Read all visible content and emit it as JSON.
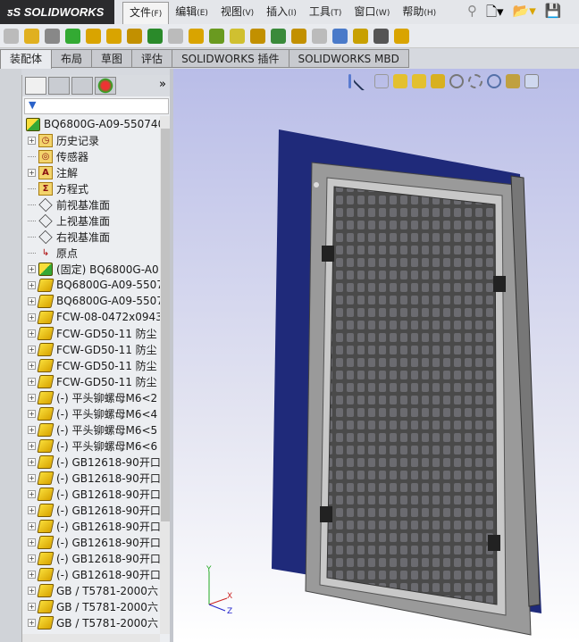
{
  "app": {
    "logo": "SOLIDWORKS"
  },
  "menu": [
    {
      "label": "文件",
      "key": "(F)"
    },
    {
      "label": "编辑",
      "key": "(E)"
    },
    {
      "label": "视图",
      "key": "(V)"
    },
    {
      "label": "插入",
      "key": "(I)"
    },
    {
      "label": "工具",
      "key": "(T)"
    },
    {
      "label": "窗口",
      "key": "(W)"
    },
    {
      "label": "帮助",
      "key": "(H)"
    }
  ],
  "tabs": [
    "装配体",
    "布局",
    "草图",
    "评估",
    "SOLIDWORKS 插件",
    "SOLIDWORKS MBD"
  ],
  "panel": {
    "more": "»",
    "filter": "▼"
  },
  "tree": {
    "root": "BQ6800G-A09-550740",
    "items": [
      {
        "label": "历史记录",
        "icon": "history-folder",
        "exp": true
      },
      {
        "label": "传感器",
        "icon": "sensor-folder",
        "exp": false
      },
      {
        "label": "注解",
        "icon": "annotation-folder",
        "exp": true
      },
      {
        "label": "方程式",
        "icon": "equation-folder",
        "exp": false
      },
      {
        "label": "前视基准面",
        "icon": "plane",
        "exp": false
      },
      {
        "label": "上视基准面",
        "icon": "plane",
        "exp": false
      },
      {
        "label": "右视基准面",
        "icon": "plane",
        "exp": false
      },
      {
        "label": "原点",
        "icon": "origin",
        "exp": false
      },
      {
        "label": "(固定) BQ6800G-A0",
        "icon": "assembly",
        "exp": true
      },
      {
        "label": "BQ6800G-A09-5507",
        "icon": "part",
        "exp": true
      },
      {
        "label": "BQ6800G-A09-5507",
        "icon": "part",
        "exp": true
      },
      {
        "label": "FCW-08-0472x0943",
        "icon": "part",
        "exp": true
      },
      {
        "label": "FCW-GD50-11 防尘",
        "icon": "part",
        "exp": true
      },
      {
        "label": "FCW-GD50-11 防尘",
        "icon": "part",
        "exp": true
      },
      {
        "label": "FCW-GD50-11 防尘",
        "icon": "part",
        "exp": true
      },
      {
        "label": "FCW-GD50-11 防尘",
        "icon": "part",
        "exp": true
      },
      {
        "label": "(-) 平头铆螺母M6<2",
        "icon": "part",
        "exp": true
      },
      {
        "label": "(-) 平头铆螺母M6<4",
        "icon": "part",
        "exp": true
      },
      {
        "label": "(-) 平头铆螺母M6<5",
        "icon": "part",
        "exp": true
      },
      {
        "label": "(-) 平头铆螺母M6<6",
        "icon": "part",
        "exp": true
      },
      {
        "label": "(-) GB12618-90开口",
        "icon": "part",
        "exp": true
      },
      {
        "label": "(-) GB12618-90开口",
        "icon": "part",
        "exp": true
      },
      {
        "label": "(-) GB12618-90开口",
        "icon": "part",
        "exp": true
      },
      {
        "label": "(-) GB12618-90开口",
        "icon": "part",
        "exp": true
      },
      {
        "label": "(-) GB12618-90开口",
        "icon": "part",
        "exp": true
      },
      {
        "label": "(-) GB12618-90开口",
        "icon": "part",
        "exp": true
      },
      {
        "label": "(-) GB12618-90开口",
        "icon": "part",
        "exp": true
      },
      {
        "label": "(-) GB12618-90开口",
        "icon": "part",
        "exp": true
      },
      {
        "label": "GB / T5781-2000六",
        "icon": "part",
        "exp": true
      },
      {
        "label": "GB / T5781-2000六",
        "icon": "part",
        "exp": true
      },
      {
        "label": "GB / T5781-2000六",
        "icon": "part",
        "exp": true
      }
    ]
  },
  "triad": {
    "x": "X",
    "y": "Y",
    "z": "Z"
  }
}
